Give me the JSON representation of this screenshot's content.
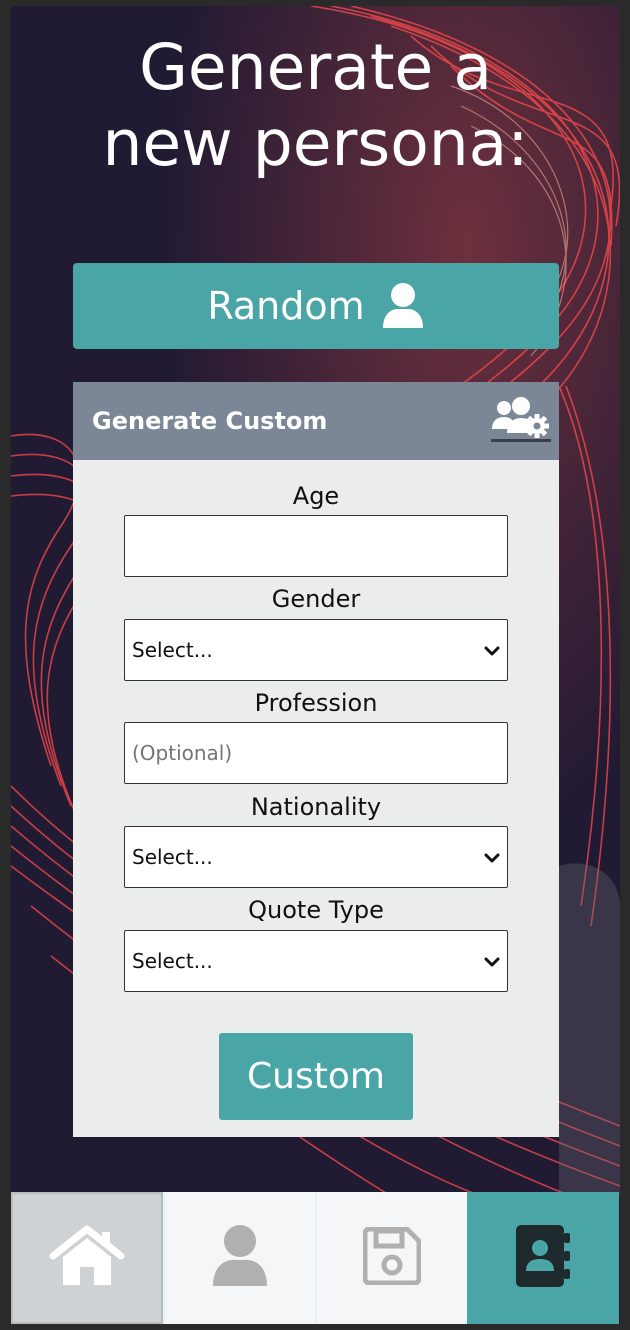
{
  "page": {
    "title_line1": "Generate a",
    "title_line2": "new persona:"
  },
  "random_button": {
    "label": "Random",
    "icon": "user-icon"
  },
  "custom_card": {
    "header_title": "Generate Custom",
    "header_icon": "users-gear-icon",
    "fields": {
      "age": {
        "label": "Age",
        "value": ""
      },
      "gender": {
        "label": "Gender",
        "selected": "Select..."
      },
      "profession": {
        "label": "Profession",
        "placeholder": "(Optional)"
      },
      "nationality": {
        "label": "Nationality",
        "selected": "Select..."
      },
      "quote_type": {
        "label": "Quote Type",
        "selected": "Select..."
      }
    },
    "submit_label": "Custom"
  },
  "bottom_nav": {
    "items": [
      {
        "name": "home",
        "icon": "home-icon"
      },
      {
        "name": "persona",
        "icon": "user-icon"
      },
      {
        "name": "saved",
        "icon": "floppy-disk-icon"
      },
      {
        "name": "contacts",
        "icon": "address-book-icon"
      }
    ]
  },
  "colors": {
    "accent": "#4aa5a6",
    "card_header": "#7b8796",
    "card_body": "#ebecec",
    "background": "#211a33"
  }
}
